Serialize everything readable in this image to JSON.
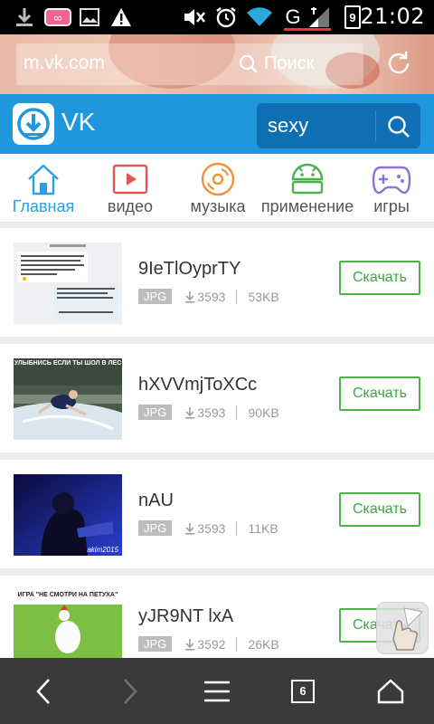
{
  "status_bar": {
    "time": "21:02",
    "battery_level": "9",
    "network_type": "G",
    "notification_badge": "∞",
    "icons": [
      "download-icon",
      "voicemail-icon",
      "image-icon",
      "warning-icon",
      "mute-icon",
      "alarm-icon",
      "wifi-icon",
      "signal-icon",
      "battery-icon"
    ],
    "network_underline_color": "#e53935"
  },
  "browser": {
    "url": "m.vk.com",
    "search_placeholder": "Поиск"
  },
  "header": {
    "title": "VK",
    "search_value": "sexy",
    "color": "#1e97dc"
  },
  "tabs": [
    {
      "label": "Главная",
      "icon": "home-icon",
      "active": true
    },
    {
      "label": "видео",
      "icon": "video-icon",
      "active": false
    },
    {
      "label": "музыка",
      "icon": "music-disc-icon",
      "active": false
    },
    {
      "label": "применение",
      "icon": "android-icon",
      "active": false
    },
    {
      "label": "игры",
      "icon": "gamepad-icon",
      "active": false
    }
  ],
  "items": [
    {
      "title": "9IeTlOyprTY",
      "format": "JPG",
      "downloads": "3593",
      "size": "53KB",
      "button": "Скачать"
    },
    {
      "title": "hXVVmjToXCc",
      "format": "JPG",
      "downloads": "3593",
      "size": "90KB",
      "button": "Скачать"
    },
    {
      "title": "nAU",
      "format": "JPG",
      "downloads": "3593",
      "size": "11KB",
      "button": "Скачать"
    },
    {
      "title": "yJR9NT lxA",
      "format": "JPG",
      "downloads": "3592",
      "size": "26KB",
      "button": "Скачать"
    }
  ],
  "thumb_texts": {
    "t2_caption": "УЛЫБНИСЬ ЕСЛИ ТЫ ШОЛ В ЛЕС",
    "t3_caption": "akim2015",
    "t4_caption": "ИГРА \"НЕ СМОТРИ НА ПЕТУХА\""
  },
  "bottom_nav": {
    "tab_count": "6",
    "icons": [
      "back-icon",
      "forward-icon",
      "menu-icon",
      "tabs-icon",
      "home-icon"
    ]
  },
  "accent_green": "#48b44a"
}
